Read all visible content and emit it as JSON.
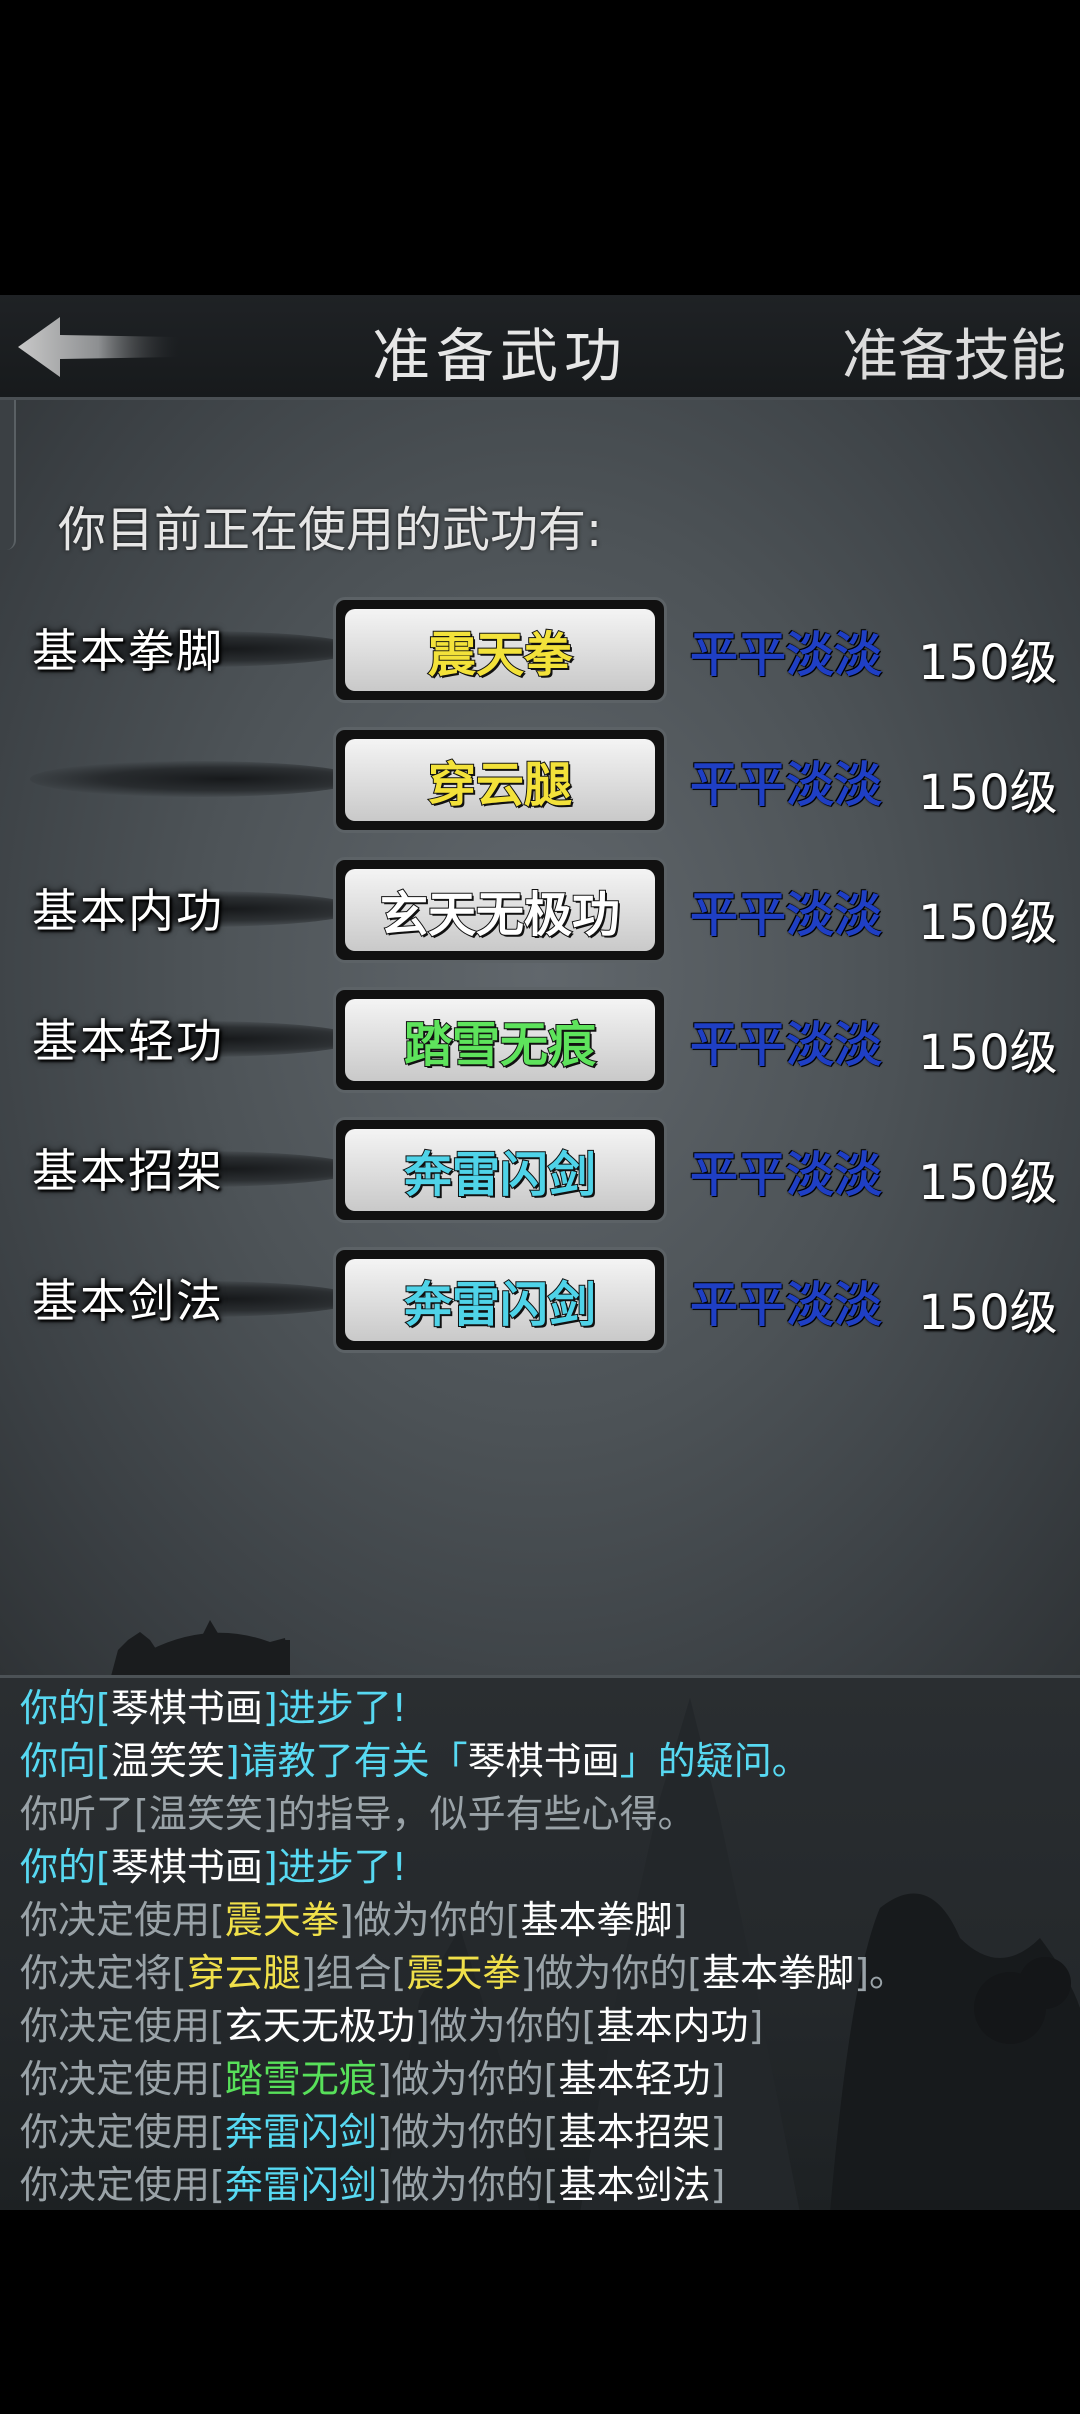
{
  "header": {
    "back_icon": "arrow-left-icon",
    "title": "准备武功",
    "right_tab": "准备技能"
  },
  "intro": "你目前正在使用的武功有:",
  "rows": [
    {
      "category": "基本拳脚",
      "skill": "震天拳",
      "skill_color": "#f3e23a",
      "rank": "平平淡淡",
      "level": "150级"
    },
    {
      "category": "",
      "skill": "穿云腿",
      "skill_color": "#f3e23a",
      "rank": "平平淡淡",
      "level": "150级"
    },
    {
      "category": "基本内功",
      "skill": "玄天无极功",
      "skill_color": "#ffffff",
      "rank": "平平淡淡",
      "level": "150级"
    },
    {
      "category": "基本轻功",
      "skill": "踏雪无痕",
      "skill_color": "#5ee35c",
      "rank": "平平淡淡",
      "level": "150级"
    },
    {
      "category": "基本招架",
      "skill": "奔雷闪剑",
      "skill_color": "#4fd3e8",
      "rank": "平平淡淡",
      "level": "150级"
    },
    {
      "category": "基本剑法",
      "skill": "奔雷闪剑",
      "skill_color": "#4fd3e8",
      "rank": "平平淡淡",
      "level": "150级"
    }
  ],
  "log": [
    [
      [
        "c-cyan",
        "你的["
      ],
      [
        "c-white",
        "琴棋书画"
      ],
      [
        "c-cyan",
        "]进步了!"
      ]
    ],
    [
      [
        "c-cyan",
        "你向["
      ],
      [
        "c-white",
        "温笑笑"
      ],
      [
        "c-cyan",
        "]请教了有关「"
      ],
      [
        "c-white",
        "琴棋书画"
      ],
      [
        "c-cyan",
        "」的疑问。"
      ]
    ],
    [
      [
        "c-gray",
        "你听了[温笑笑]的指导，似乎有些心得。"
      ]
    ],
    [
      [
        "c-cyan",
        "你的["
      ],
      [
        "c-white",
        "琴棋书画"
      ],
      [
        "c-cyan",
        "]进步了!"
      ]
    ],
    [
      [
        "c-gray",
        "你决定使用["
      ],
      [
        "c-yellow",
        "震天拳"
      ],
      [
        "c-gray",
        "]做为你的["
      ],
      [
        "c-white",
        "基本拳脚"
      ],
      [
        "c-gray",
        "]"
      ]
    ],
    [
      [
        "c-gray",
        "你决定将["
      ],
      [
        "c-yellow",
        "穿云腿"
      ],
      [
        "c-gray",
        "]组合["
      ],
      [
        "c-yellow",
        "震天拳"
      ],
      [
        "c-gray",
        "]做为你的["
      ],
      [
        "c-white",
        "基本拳脚"
      ],
      [
        "c-gray",
        "]。"
      ]
    ],
    [
      [
        "c-gray",
        "你决定使用["
      ],
      [
        "c-white",
        "玄天无极功"
      ],
      [
        "c-gray",
        "]做为你的["
      ],
      [
        "c-white",
        "基本内功"
      ],
      [
        "c-gray",
        "]"
      ]
    ],
    [
      [
        "c-gray",
        "你决定使用["
      ],
      [
        "c-green",
        "踏雪无痕"
      ],
      [
        "c-gray",
        "]做为你的["
      ],
      [
        "c-white",
        "基本轻功"
      ],
      [
        "c-gray",
        "]"
      ]
    ],
    [
      [
        "c-gray",
        "你决定使用["
      ],
      [
        "c-cyan",
        "奔雷闪剑"
      ],
      [
        "c-gray",
        "]做为你的["
      ],
      [
        "c-white",
        "基本招架"
      ],
      [
        "c-gray",
        "]"
      ]
    ],
    [
      [
        "c-gray",
        "你决定使用["
      ],
      [
        "c-cyan",
        "奔雷闪剑"
      ],
      [
        "c-gray",
        "]做为你的["
      ],
      [
        "c-white",
        "基本剑法"
      ],
      [
        "c-gray",
        "]"
      ]
    ]
  ]
}
